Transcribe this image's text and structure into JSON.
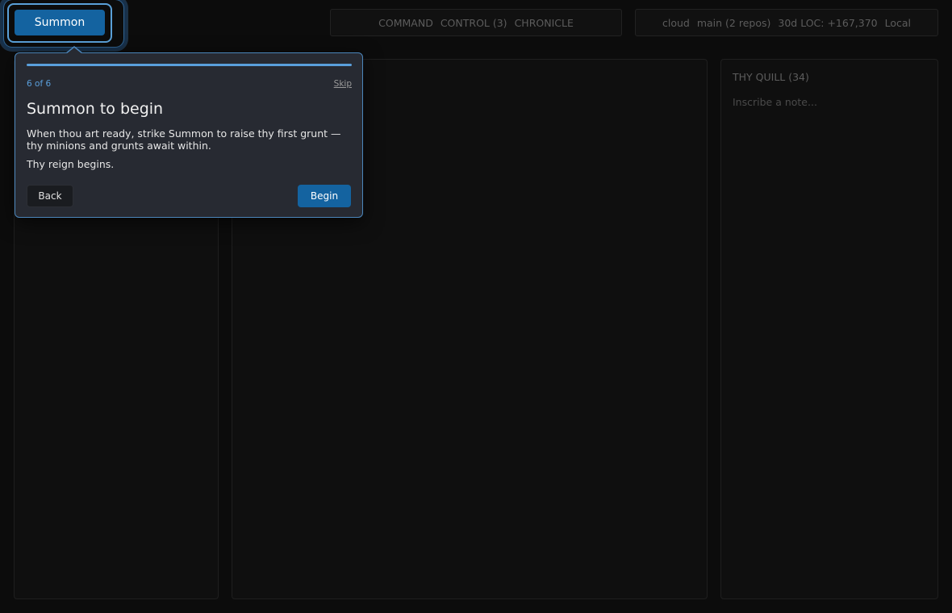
{
  "header": {
    "summon_label": "Summon",
    "nav": [
      "COMMAND",
      "CONTROL (3)",
      "CHRONICLE"
    ],
    "status": [
      "cloud",
      "main (2 repos)",
      "30d LOC: +167,370",
      "Local"
    ]
  },
  "tour": {
    "step": "6 of 6",
    "progress": 1.0,
    "skip_label": "Skip",
    "title": "Summon to begin",
    "body": "When thou art ready, strike Summon to raise thy first grunt — thy minions and grunts await within.",
    "body2": "Thy reign begins.",
    "back_label": "Back",
    "begin_label": "Begin"
  },
  "quill": {
    "title": "THY QUILL (34)",
    "placeholder": "Inscribe a note..."
  },
  "colors": {
    "accent": "#1463a0",
    "highlight": "#5a9fdc",
    "background": "#0c0c0c"
  }
}
